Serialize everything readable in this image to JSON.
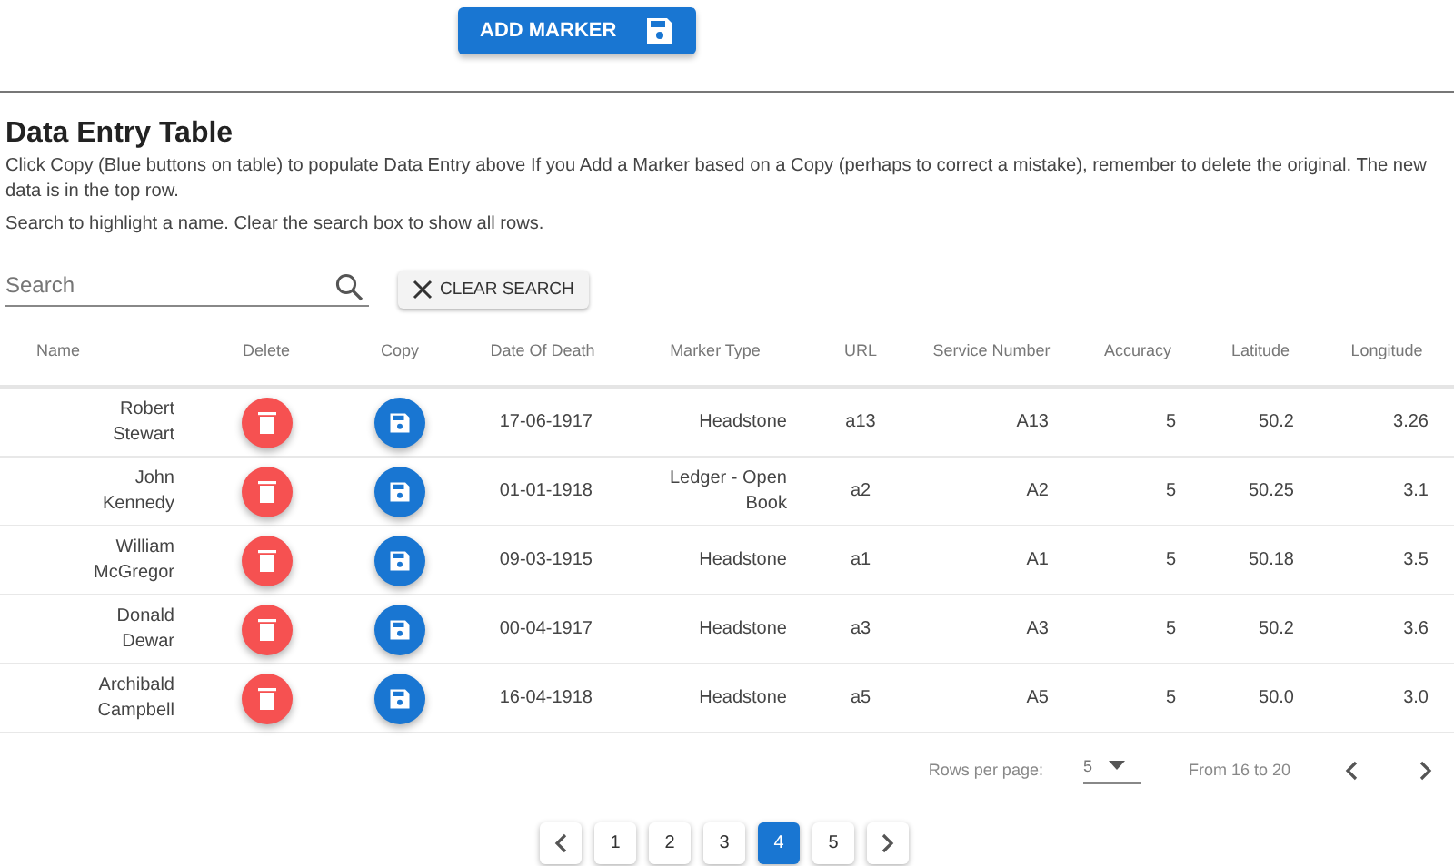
{
  "add_button": {
    "label": "ADD MARKER"
  },
  "section": {
    "title": "Data Entry Table",
    "description": "Click Copy (Blue buttons on table) to populate Data Entry above If you Add a Marker based on a Copy (perhaps to correct a mistake), remember to delete the original. The new data is in the top row.",
    "hint": "Search to highlight a name. Clear the search box to show all rows."
  },
  "search": {
    "placeholder": "Search",
    "clear_label": "CLEAR SEARCH"
  },
  "table": {
    "columns": [
      "Name",
      "Delete",
      "Copy",
      "Date Of Death",
      "Marker Type",
      "URL",
      "Service Number",
      "Accuracy",
      "Latitude",
      "Longitude"
    ],
    "rows": [
      {
        "name": "Robert Stewart",
        "date": "17-06-1917",
        "marker_type": "Headstone",
        "url": "a13",
        "service_number": "A13",
        "accuracy": "5",
        "latitude": "50.2",
        "longitude": "3.26"
      },
      {
        "name": "John Kennedy",
        "date": "01-01-1918",
        "marker_type": "Ledger - Open Book",
        "url": "a2",
        "service_number": "A2",
        "accuracy": "5",
        "latitude": "50.25",
        "longitude": "3.1"
      },
      {
        "name": "William McGregor",
        "date": "09-03-1915",
        "marker_type": "Headstone",
        "url": "a1",
        "service_number": "A1",
        "accuracy": "5",
        "latitude": "50.18",
        "longitude": "3.5"
      },
      {
        "name": "Donald Dewar",
        "date": "00-04-1917",
        "marker_type": "Headstone",
        "url": "a3",
        "service_number": "A3",
        "accuracy": "5",
        "latitude": "50.2",
        "longitude": "3.6"
      },
      {
        "name": "Archibald Campbell",
        "date": "16-04-1918",
        "marker_type": "Headstone",
        "url": "a5",
        "service_number": "A5",
        "accuracy": "5",
        "latitude": "50.0",
        "longitude": "3.0"
      }
    ]
  },
  "table_footer": {
    "rows_per_page_label": "Rows per page:",
    "rows_per_page": "5",
    "range": "From 16 to 20"
  },
  "pagination": {
    "pages": [
      {
        "label": "1",
        "selected": false
      },
      {
        "label": "2",
        "selected": false
      },
      {
        "label": "3",
        "selected": false
      },
      {
        "label": "4",
        "selected": true
      },
      {
        "label": "5",
        "selected": false
      }
    ]
  }
}
